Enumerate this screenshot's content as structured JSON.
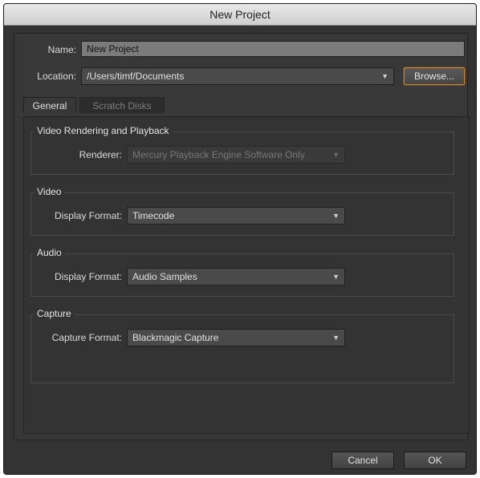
{
  "window": {
    "title": "New Project"
  },
  "name_field": {
    "label": "Name:",
    "value": "New Project"
  },
  "location_field": {
    "label": "Location:",
    "value": "/Users/timf/Documents",
    "browse_label": "Browse..."
  },
  "tabs": [
    {
      "label": "General",
      "active": true
    },
    {
      "label": "Scratch Disks",
      "active": false
    }
  ],
  "groups": {
    "video_rendering": {
      "title": "Video Rendering and Playback",
      "renderer_label": "Renderer:",
      "renderer_value": "Mercury Playback Engine Software Only"
    },
    "video": {
      "title": "Video",
      "display_format_label": "Display Format:",
      "display_format_value": "Timecode"
    },
    "audio": {
      "title": "Audio",
      "display_format_label": "Display Format:",
      "display_format_value": "Audio Samples"
    },
    "capture": {
      "title": "Capture",
      "capture_format_label": "Capture Format:",
      "capture_format_value": "Blackmagic Capture"
    }
  },
  "footer": {
    "cancel_label": "Cancel",
    "ok_label": "OK"
  },
  "icons": {
    "dropdown_arrow": "chevron-down-icon"
  },
  "colors": {
    "focus_ring": "#c8842e",
    "window_bg": "#333333"
  }
}
